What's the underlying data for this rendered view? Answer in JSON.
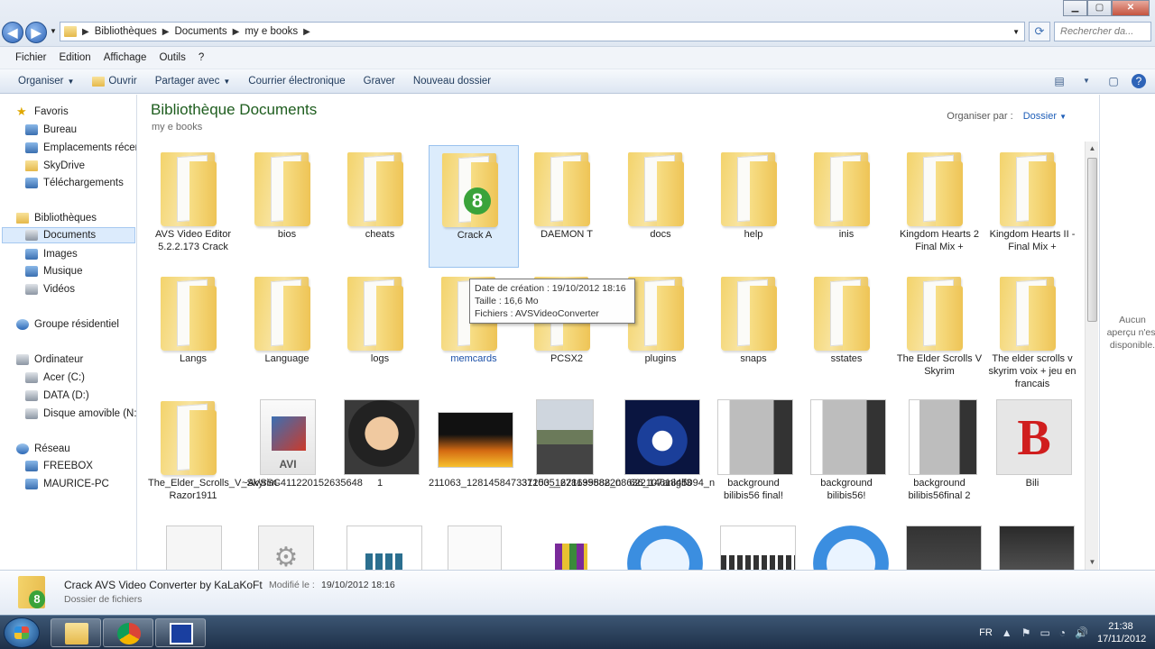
{
  "window": {
    "breadcrumbs": [
      "Bibliothèques",
      "Documents",
      "my e books"
    ],
    "search_placeholder": "Rechercher da..."
  },
  "menu": [
    "Fichier",
    "Edition",
    "Affichage",
    "Outils",
    "?"
  ],
  "commands": {
    "organiser": "Organiser",
    "ouvrir": "Ouvrir",
    "partager": "Partager avec",
    "courrier": "Courrier électronique",
    "graver": "Graver",
    "nouveau": "Nouveau dossier"
  },
  "nav": {
    "favoris": "Favoris",
    "bureau": "Bureau",
    "emplacements": "Emplacements récer",
    "skydrive": "SkyDrive",
    "telechargements": "Téléchargements",
    "bibliotheques": "Bibliothèques",
    "documents": "Documents",
    "images": "Images",
    "musique": "Musique",
    "videos": "Vidéos",
    "groupe": "Groupe résidentiel",
    "ordinateur": "Ordinateur",
    "acer": "Acer (C:)",
    "data": "DATA (D:)",
    "disque": "Disque amovible (N:",
    "reseau": "Réseau",
    "freebox": "FREEBOX",
    "maurice": "MAURICE-PC"
  },
  "content": {
    "title": "Bibliothèque Documents",
    "subtitle": "my e books",
    "arrange_label": "Organiser par :",
    "arrange_value": "Dossier"
  },
  "items_row1": [
    "AVS Video Editor 5.2.2.173 Crack",
    "bios",
    "cheats",
    "Crack AVS Video Converter by KaLaKoFt",
    "DAEMON Tools",
    "docs",
    "help",
    "inis",
    "Kingdom Hearts 2 Final Mix +",
    "Kingdom Hearts II - Final Mix +"
  ],
  "items_row1_visible": [
    "AVS Video Editor 5.2.2.173 Crack",
    "bios",
    "cheats",
    "Crack A",
    "DAEMON T",
    "docs",
    "help",
    "inis",
    "Kingdom Hearts 2 Final Mix +",
    "Kingdom Hearts II - Final Mix +"
  ],
  "items_row2": [
    "Langs",
    "Language",
    "logs",
    "memcards",
    "PCSX2",
    "plugins",
    "snaps",
    "sstates",
    "The Elder Scrolls V Skyrim",
    "The elder scrolls v skyrim  voix + jeu en francais"
  ],
  "items_row3": [
    "The_Elder_Scrolls_V_Skyrim-Razor1911",
    "~AVSSC411220152635648",
    "1",
    "211063_128145847337150_1621699888_n",
    "312035_278135582208636_1461845094_n",
    "622107anigif3",
    "background bilibis56 final!",
    "background bilibis56!",
    "background bilibis56final 2",
    "Bili"
  ],
  "tooltip": {
    "date": "Date de création : 19/10/2012 18:16",
    "size": "Taille : 16,6 Mo",
    "files": "Fichiers : AVSVideoConverter"
  },
  "preview_text": "Aucun aperçu n'est disponible.",
  "details": {
    "name": "Crack AVS Video Converter by KaLaKoFt",
    "modified_label": "Modifié le :",
    "modified": "19/10/2012 18:16",
    "type": "Dossier de fichiers"
  },
  "taskbar": {
    "lang": "FR",
    "time": "21:38",
    "date": "17/11/2012"
  },
  "icons": [
    "back-arrow-icon",
    "forward-arrow-icon",
    "refresh-icon",
    "search-icon",
    "star-icon",
    "folder-icon",
    "avi-file-icon",
    "settings-icon"
  ]
}
